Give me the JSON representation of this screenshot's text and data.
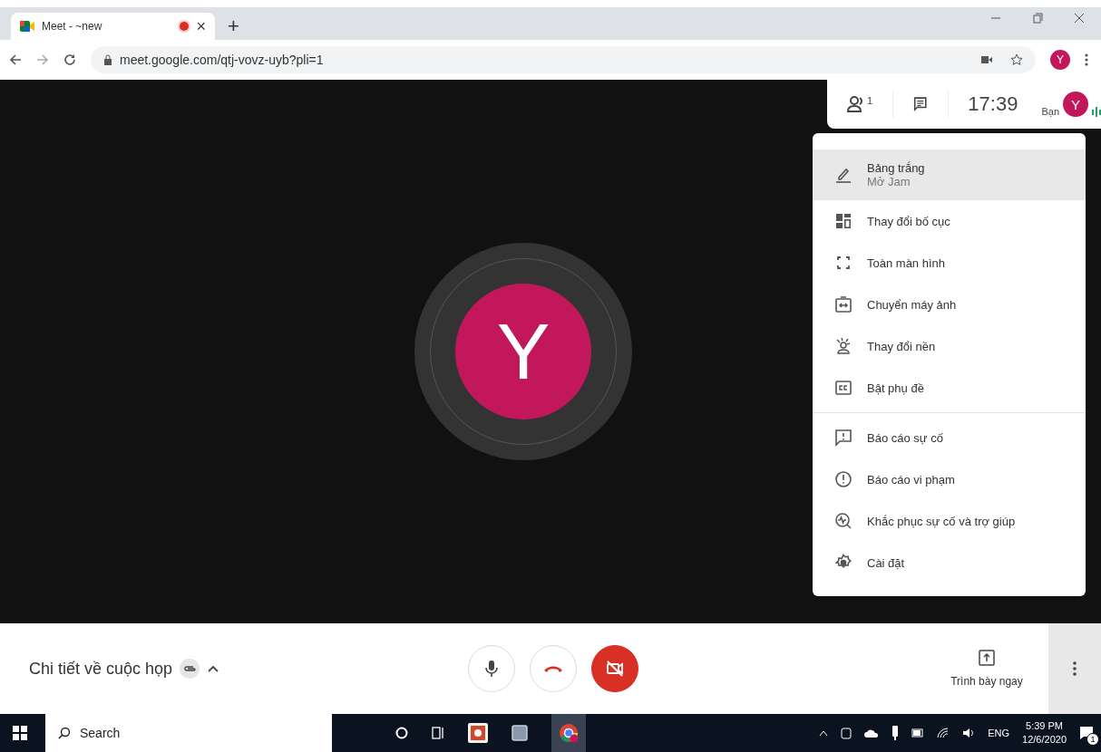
{
  "browser": {
    "tab": {
      "title": "Meet - ~new",
      "recording": true,
      "close": "×"
    },
    "new_tab": "+",
    "url": "meet.google.com/qtj-vovz-uyb?pli=1",
    "profile": "Y"
  },
  "top_bar": {
    "participants_count": "1",
    "time": "17:39",
    "self_label": "Bạn",
    "self_avatar": "Y"
  },
  "tile": {
    "avatar": "Y"
  },
  "menu": {
    "groups": [
      [
        {
          "label": "Bảng trắng",
          "sublabel": "Mở Jam",
          "selected": true
        },
        {
          "label": "Thay đổi bố cục",
          "selected": false
        },
        {
          "label": "Toàn màn hình",
          "selected": false
        },
        {
          "label": "Chuyển máy ảnh",
          "selected": false
        },
        {
          "label": "Thay đổi nền",
          "selected": false
        },
        {
          "label": "Bật phụ đề",
          "selected": false
        }
      ],
      [
        {
          "label": "Báo cáo sự cố",
          "selected": false
        },
        {
          "label": "Báo cáo vi phạm",
          "selected": false
        },
        {
          "label": "Khắc phục sự cố và trợ giúp",
          "selected": false
        },
        {
          "label": "Cài đặt",
          "selected": false
        }
      ]
    ]
  },
  "bottom_bar": {
    "meeting_details": "Chi tiết về cuộc họp",
    "mic_on": true,
    "camera_on": false,
    "present": "Trình bày ngay"
  },
  "taskbar": {
    "search": "Search",
    "language": "ENG",
    "time": "5:39 PM",
    "date": "12/6/2020",
    "notifications": "1"
  }
}
